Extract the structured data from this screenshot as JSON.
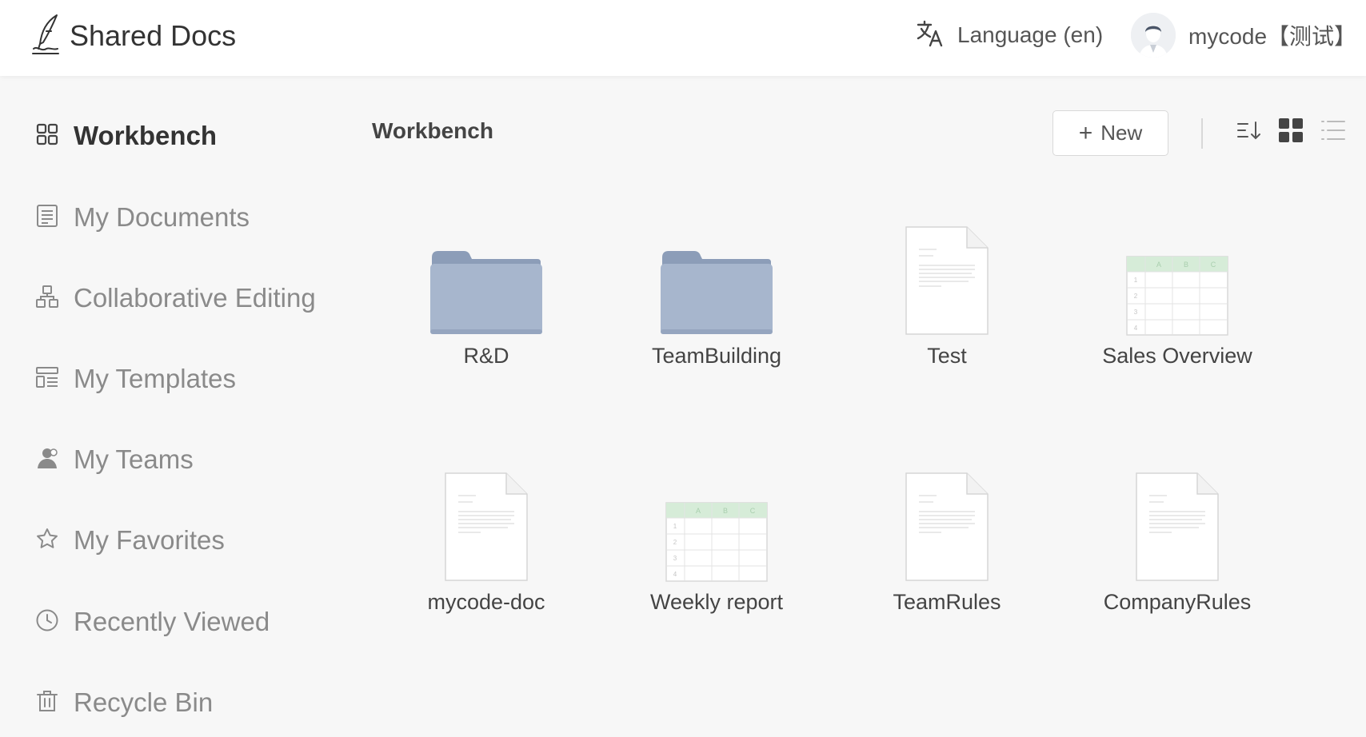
{
  "app": {
    "title": "Shared Docs"
  },
  "header": {
    "language_label": "Language (en)",
    "user_name": "mycode【测试】"
  },
  "sidebar": {
    "items": [
      {
        "label": "Workbench",
        "icon": "grid-icon",
        "active": true
      },
      {
        "label": "My Documents",
        "icon": "document-list-icon"
      },
      {
        "label": "Collaborative Editing",
        "icon": "collaborate-icon"
      },
      {
        "label": "My Templates",
        "icon": "templates-icon"
      },
      {
        "label": "My Teams",
        "icon": "team-icon"
      },
      {
        "label": "My Favorites",
        "icon": "star-icon"
      },
      {
        "label": "Recently Viewed",
        "icon": "clock-icon"
      },
      {
        "label": "Recycle Bin",
        "icon": "trash-icon"
      }
    ]
  },
  "main": {
    "title": "Workbench",
    "new_button": {
      "plus": "+",
      "label": "New"
    },
    "view_icons": [
      "sort-icon",
      "grid-view-icon",
      "list-view-icon"
    ],
    "files": [
      {
        "name": "R&D",
        "type": "folder"
      },
      {
        "name": "TeamBuilding",
        "type": "folder"
      },
      {
        "name": "Test",
        "type": "document"
      },
      {
        "name": "Sales Overview",
        "type": "spreadsheet"
      },
      {
        "name": "mycode-doc",
        "type": "document"
      },
      {
        "name": "Weekly report",
        "type": "spreadsheet"
      },
      {
        "name": "TeamRules",
        "type": "document"
      },
      {
        "name": "CompanyRules",
        "type": "document"
      }
    ],
    "sheet_headers": [
      "A",
      "B",
      "C"
    ],
    "sheet_rows": [
      "1",
      "2",
      "3",
      "4"
    ]
  },
  "colors": {
    "folder": "#a7b6cd",
    "folder_dark": "#8c9db8",
    "sheet_header": "#d6ecd8",
    "active_text": "#333333",
    "muted_text": "#8a8a8a"
  }
}
